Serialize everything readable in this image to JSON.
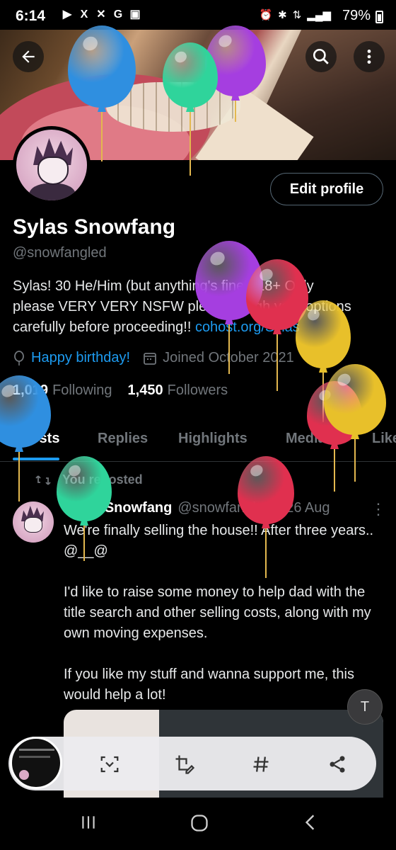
{
  "status_bar": {
    "time": "6:14",
    "notification_icons": [
      "youtube-icon",
      "x-icon",
      "pinwheel-icon",
      "google-icon",
      "gallery-icon"
    ],
    "notification_glyphs": [
      "▶",
      "X",
      "✕",
      "G",
      "▣"
    ],
    "system_icons": [
      "alarm-icon",
      "bluetooth-icon",
      "data-icon",
      "signal-icon"
    ],
    "battery": "79%"
  },
  "header": {
    "back_icon": "arrow-left-icon",
    "search_icon": "search-icon",
    "more_icon": "more-vertical-icon"
  },
  "profile": {
    "display_name": "Sylas Snowfang",
    "handle": "@snowfangled",
    "edit_button": "Edit profile",
    "bio_line1": "Sylas!  30  He/Him (but anything's fine!)  18+ Only",
    "bio_line2": "please VERY VERY NSFW please weigh your options",
    "bio_line3_prefix": "carefully before proceeding!!  ",
    "bio_link": "cohost.org/Sylas",
    "birthday": "Happy birthday!",
    "joined": "Joined October 2021",
    "following_count": "1,019",
    "following_label": "Following",
    "followers_count": "1,450",
    "followers_label": "Followers"
  },
  "tabs": [
    "Posts",
    "Replies",
    "Highlights",
    "Media",
    "Likes"
  ],
  "active_tab": "Posts",
  "post": {
    "repost_label": "You reposted",
    "author_name": "Sylas Snowfang",
    "author_handle": "@snowfangled",
    "date": "· 26 Aug",
    "paragraphs": [
      "We're finally selling the house!!  After three years..  @__@",
      "I'd like to raise some money to help dad with the title search and other selling costs, along with my own moving expenses.",
      "If you like my stuff and wanna support me, this would help a lot!"
    ]
  },
  "overlay": {
    "text_button": "T",
    "actions": [
      "scan-icon",
      "crop-edit-icon",
      "hashtag-icon",
      "share-icon"
    ]
  },
  "nav": [
    "recent-apps-icon",
    "home-icon",
    "back-icon"
  ],
  "colors": {
    "accent": "#1d9bf0",
    "muted": "#71767b",
    "text": "#e7e9ea",
    "background": "#000000"
  },
  "balloons": [
    {
      "color": "#2f8fe0"
    },
    {
      "color": "#a53ee0"
    },
    {
      "color": "#2fd49b"
    },
    {
      "color": "#a53ee0"
    },
    {
      "color": "#e0304f"
    },
    {
      "color": "#e8c02a"
    },
    {
      "color": "#2f8fe0"
    },
    {
      "color": "#e0304f"
    },
    {
      "color": "#e8c02a"
    },
    {
      "color": "#2fd49b"
    },
    {
      "color": "#e0304f"
    }
  ]
}
